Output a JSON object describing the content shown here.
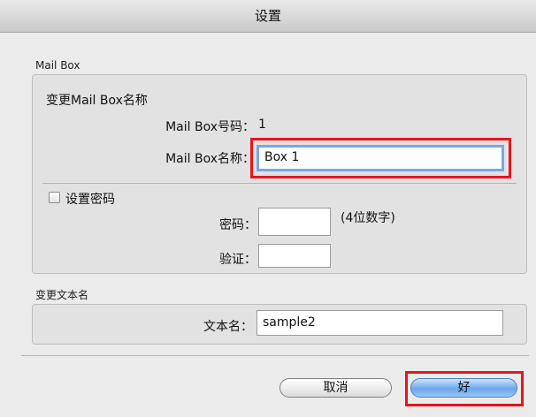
{
  "window": {
    "title": "设置"
  },
  "mailbox_group": {
    "label": "Mail Box",
    "section_title": "变更Mail Box名称",
    "number_label": "Mail Box号码：",
    "number_value": "1",
    "name_label": "Mail Box名称：",
    "name_value": "Box 1"
  },
  "password_group": {
    "checkbox_label": "设置密码",
    "checkbox_checked": false,
    "password_label": "密码：",
    "password_value": "",
    "password_hint": "(4位数字)",
    "verify_label": "验证：",
    "verify_value": ""
  },
  "document_group": {
    "label": "变更文本名",
    "name_label": "文本名：",
    "name_value": "sample2"
  },
  "buttons": {
    "cancel": "取消",
    "ok": "好"
  },
  "colors": {
    "highlight": "#e8141b",
    "focus": "#7aa7e6",
    "primary_button": "#6aa6eb"
  }
}
